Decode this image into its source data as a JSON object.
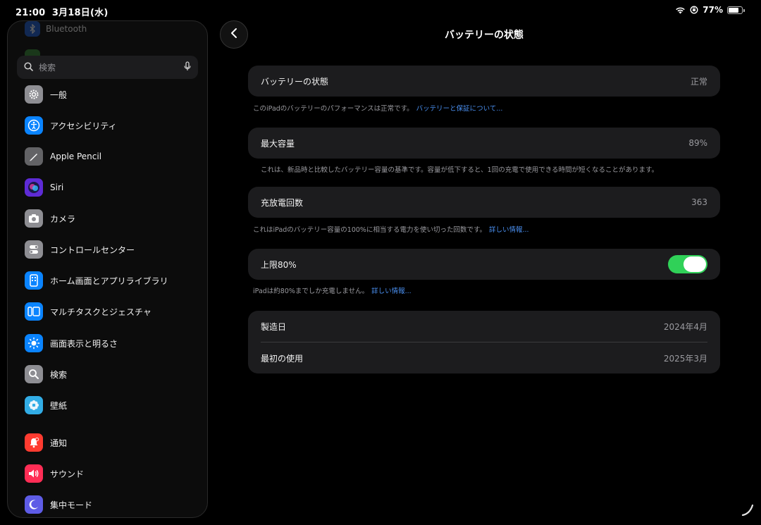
{
  "status_bar": {
    "time": "21:00",
    "date": "3月18日(水)",
    "battery_percent": "77%",
    "battery_level": 0.77
  },
  "sidebar": {
    "ghost_item_label": "Bluetooth",
    "search_placeholder": "検索",
    "items": [
      {
        "label": "一般",
        "icon": "gear-icon",
        "color": "#8e8e93"
      },
      {
        "label": "アクセシビリティ",
        "icon": "accessibility-icon",
        "color": "#0a84ff"
      },
      {
        "label": "Apple Pencil",
        "icon": "pencil-icon",
        "color": "#636366"
      },
      {
        "label": "Siri",
        "icon": "siri-icon",
        "color": "#5e2bd6"
      },
      {
        "label": "カメラ",
        "icon": "camera-icon",
        "color": "#8e8e93"
      },
      {
        "label": "コントロールセンター",
        "icon": "toggles-icon",
        "color": "#8e8e93"
      },
      {
        "label": "ホーム画面とアプリライブラリ",
        "icon": "home-screen-icon",
        "color": "#0a84ff"
      },
      {
        "label": "マルチタスクとジェスチャ",
        "icon": "multitask-icon",
        "color": "#0a84ff"
      },
      {
        "label": "画面表示と明るさ",
        "icon": "brightness-icon",
        "color": "#0a84ff"
      },
      {
        "label": "検索",
        "icon": "search-icon",
        "color": "#8e8e93"
      },
      {
        "label": "壁紙",
        "icon": "wallpaper-icon",
        "color": "#32ade6"
      },
      {
        "label": "通知",
        "icon": "bell-icon",
        "color": "#ff3b30"
      },
      {
        "label": "サウンド",
        "icon": "speaker-icon",
        "color": "#ff2d55"
      },
      {
        "label": "集中モード",
        "icon": "moon-icon",
        "color": "#5e5ce6"
      }
    ]
  },
  "main": {
    "title": "バッテリーの状態",
    "battery_health": {
      "label": "バッテリーの状態",
      "value": "正常"
    },
    "battery_health_note": "このiPadのバッテリーのパフォーマンスは正常です。",
    "battery_health_link": "バッテリーと保証について...",
    "max_capacity": {
      "label": "最大容量",
      "value": "89%"
    },
    "max_capacity_note": "これは、新品時と比較したバッテリー容量の基準です。容量が低下すると、1回の充電で使用できる時間が短くなることがあります。",
    "cycle_count": {
      "label": "充放電回数",
      "value": "363"
    },
    "cycle_count_note": "これはiPadのバッテリー容量の100%に相当する電力を使い切った回数です。",
    "cycle_count_link": "詳しい情報...",
    "limit": {
      "label": "上限80%",
      "enabled": true
    },
    "limit_note": "iPadは約80%までしか充電しません。",
    "limit_link": "詳しい情報...",
    "manufacture": {
      "label": "製造日",
      "value": "2024年4月"
    },
    "first_use": {
      "label": "最初の使用",
      "value": "2025年3月"
    }
  },
  "colors": {
    "accent": "#0a84ff",
    "link": "#4a8ff0",
    "toggle_on": "#30d158"
  }
}
